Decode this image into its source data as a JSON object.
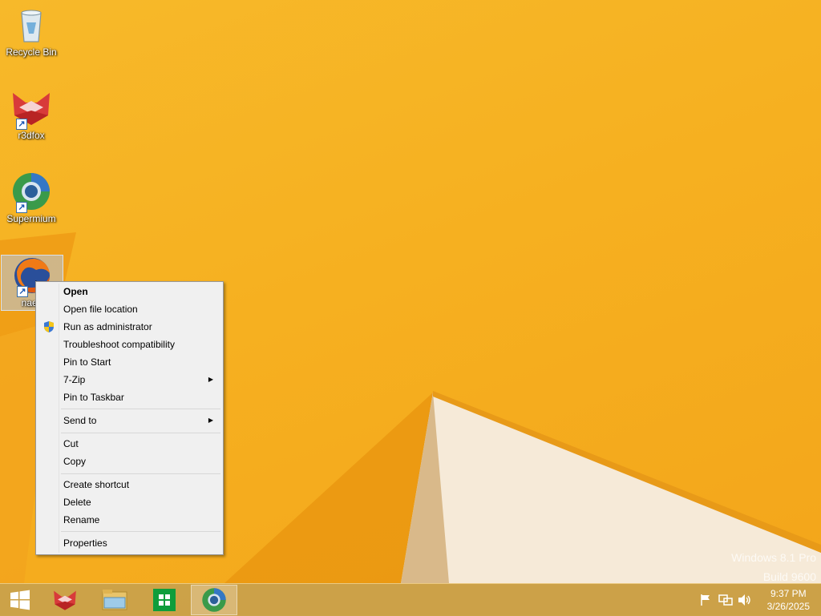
{
  "desktop": {
    "icons": [
      {
        "label": "Recycle Bin"
      },
      {
        "label": "r3dfox"
      },
      {
        "label": "Supermium"
      },
      {
        "label": "naen"
      }
    ]
  },
  "context_menu": {
    "items": [
      {
        "label": "Open"
      },
      {
        "label": "Open file location"
      },
      {
        "label": "Run as administrator"
      },
      {
        "label": "Troubleshoot compatibility"
      },
      {
        "label": "Pin to Start"
      },
      {
        "label": "7-Zip"
      },
      {
        "label": "Pin to Taskbar"
      },
      {
        "label": "Send to"
      },
      {
        "label": "Cut"
      },
      {
        "label": "Copy"
      },
      {
        "label": "Create shortcut"
      },
      {
        "label": "Delete"
      },
      {
        "label": "Rename"
      },
      {
        "label": "Properties"
      }
    ]
  },
  "watermark": {
    "line1": "Windows 8.1 Pro",
    "line2": "Build 9600"
  },
  "taskbar": {
    "clock": {
      "time": "9:37 PM",
      "date": "3/26/2025"
    }
  },
  "colors": {
    "wallpaper": "#f6b020",
    "taskbar": "#c4a050",
    "menu_bg": "#f0f0f0"
  }
}
